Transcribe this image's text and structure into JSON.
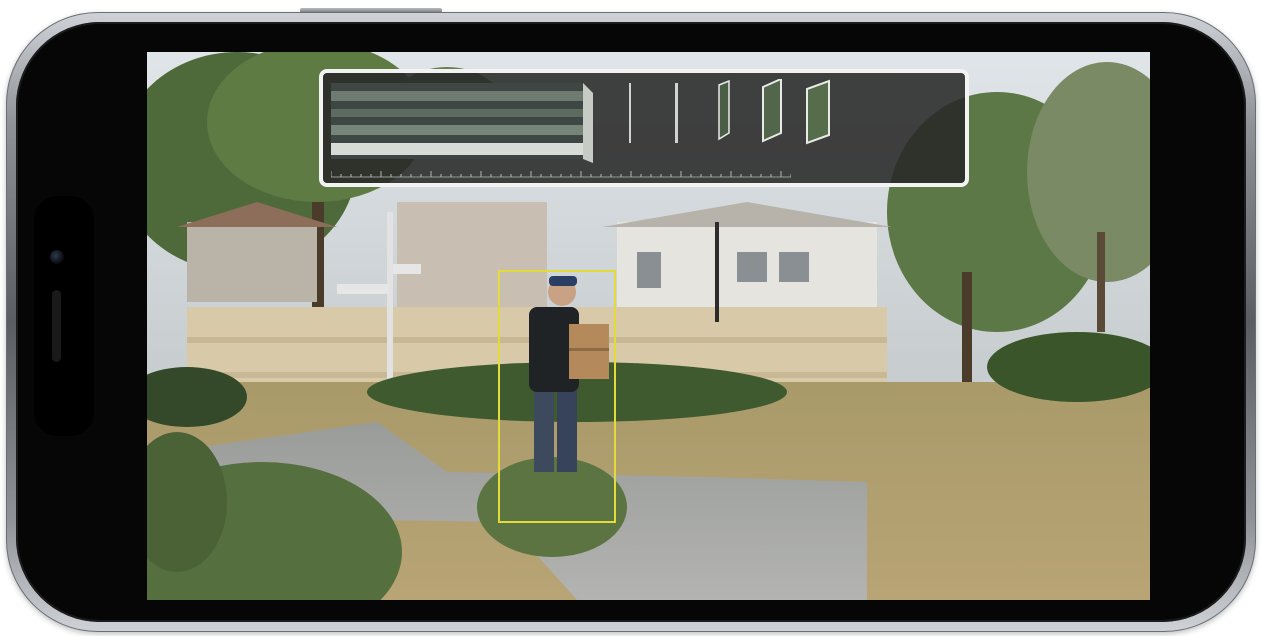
{
  "device": {
    "type": "smartphone",
    "orientation": "landscape"
  },
  "camera_view": {
    "scene_description_visible": false,
    "detection": {
      "label": "",
      "box_color": "#e2db3a"
    }
  },
  "timeline": {
    "frames_shown": 6,
    "border_color": "#f3f3f3"
  },
  "colors": {
    "phone_frame": "#8f9398",
    "bezel": "#060606",
    "detection_box": "#e2db3a"
  }
}
